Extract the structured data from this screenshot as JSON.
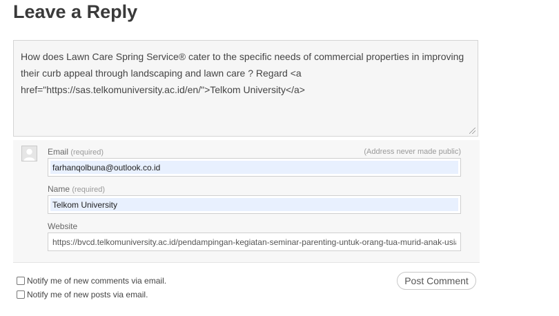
{
  "heading": "Leave a Reply",
  "comment": {
    "text": "How does Lawn Care Spring Service® cater to the specific needs of commercial properties in improving their curb appeal through landscaping and lawn care ? Regard <a href=\"https://sas.telkomuniversity.ac.id/en/\">Telkom University</a>"
  },
  "fields": {
    "email": {
      "label": "Email",
      "required": "(required)",
      "note": "(Address never made public)",
      "value": "farhanqolbuna@outlook.co.id"
    },
    "name": {
      "label": "Name",
      "required": "(required)",
      "value": "Telkom University"
    },
    "website": {
      "label": "Website",
      "value": "https://bvcd.telkomuniversity.ac.id/pendampingan-kegiatan-seminar-parenting-untuk-orang-tua-murid-anak-usia"
    }
  },
  "notify": {
    "comments_label": "Notify me of new comments via email.",
    "posts_label": "Notify me of new posts via email."
  },
  "submit_label": "Post Comment"
}
